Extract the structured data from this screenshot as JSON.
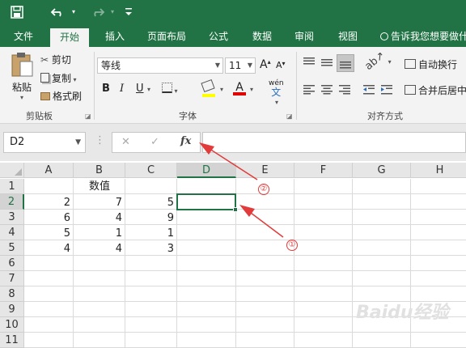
{
  "quickaccess": {
    "save": "save-icon",
    "undo": "undo-icon",
    "redo": "redo-icon",
    "customize": "customize-icon"
  },
  "tabs": {
    "file": "文件",
    "home": "开始",
    "insert": "插入",
    "layout": "页面布局",
    "formula": "公式",
    "data": "数据",
    "review": "审阅",
    "view": "视图",
    "tellme": "告诉我您想要做什"
  },
  "ribbon": {
    "clipboard": {
      "paste": "粘贴",
      "cut": "剪切",
      "copy": "复制",
      "painter": "格式刷",
      "label": "剪贴板"
    },
    "font": {
      "name": "等线",
      "size": "11",
      "bold": "B",
      "italic": "I",
      "underline": "U",
      "phonetic": "wén",
      "phonetic_char": "文",
      "label": "字体"
    },
    "align": {
      "wrap": "自动换行",
      "merge": "合并后居中",
      "label": "对齐方式"
    }
  },
  "formulabar": {
    "namebox": "D2",
    "fx": "fx",
    "cancel": "✕",
    "enter": "✓",
    "dots": "⋮",
    "value": ""
  },
  "columns": [
    "A",
    "B",
    "C",
    "D",
    "E",
    "F",
    "G",
    "H"
  ],
  "rows": [
    "1",
    "2",
    "3",
    "4",
    "5",
    "6",
    "7",
    "8",
    "9",
    "10",
    "11"
  ],
  "selected_cell": "D2",
  "cells": {
    "b1": "数值",
    "a2": "2",
    "b2": "7",
    "c2": "5",
    "a3": "6",
    "b3": "4",
    "c3": "9",
    "a4": "5",
    "b4": "1",
    "c4": "1",
    "a5": "4",
    "b5": "4",
    "c5": "3"
  },
  "annotations": {
    "one": "①",
    "two": "②",
    "color": "#e23b3b"
  },
  "colors": {
    "accent": "#217346"
  },
  "watermark": "Baidu经验"
}
